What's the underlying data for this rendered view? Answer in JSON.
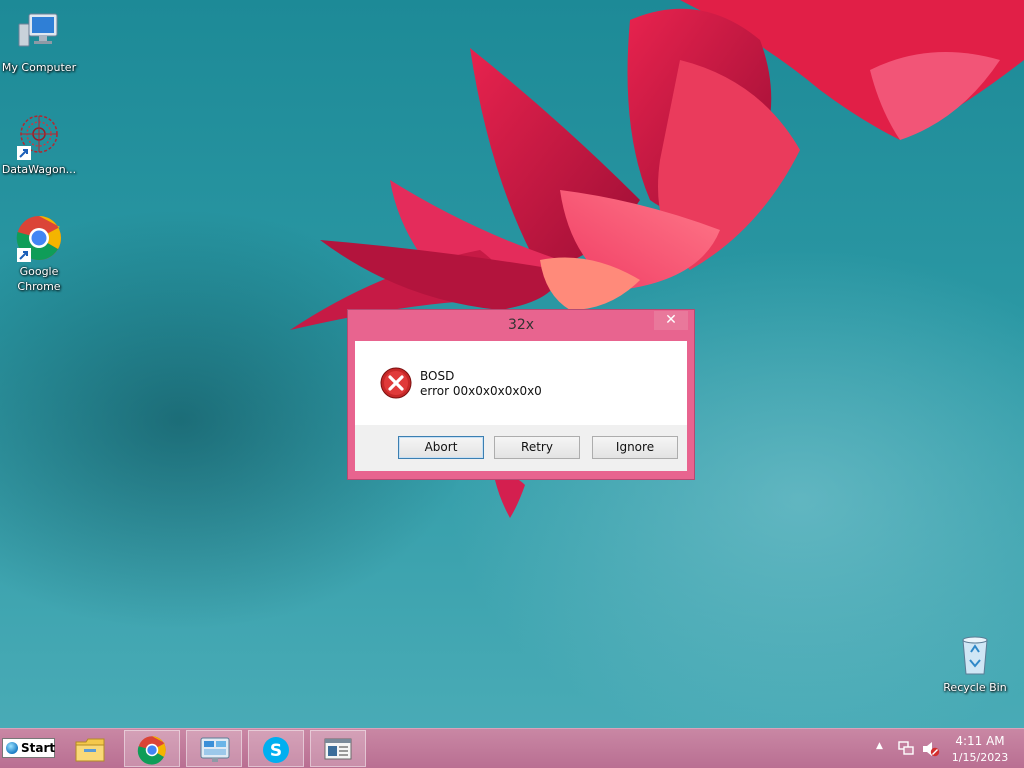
{
  "desktop": {
    "icons": [
      {
        "label": "My Computer",
        "icon": "computer-icon"
      },
      {
        "label": "DataWagon...",
        "icon": "datawagon-icon"
      },
      {
        "label": "Google Chrome",
        "icon": "chrome-icon"
      },
      {
        "label": "Recycle Bin",
        "icon": "recycle-bin-icon"
      }
    ]
  },
  "dialog": {
    "title": "32x",
    "close_glyph": "✕",
    "message_line1": "BOSD",
    "message_line2": "error 00x0x0x0x0x0",
    "icon": "error-icon",
    "buttons": {
      "abort": "Abort",
      "retry": "Retry",
      "ignore": "Ignore"
    }
  },
  "taskbar": {
    "start_label": "Start",
    "items": [
      "file-explorer-icon",
      "chrome-icon",
      "control-panel-icon",
      "skype-icon",
      "window-app-icon"
    ],
    "active_item": "window-app-icon",
    "tray": {
      "arrow": "▲",
      "network_icon": "network-icon",
      "volume_icon": "volume-muted-icon",
      "time": "4:11 AM",
      "date": "1/15/2023"
    }
  },
  "colors": {
    "dialog_frame": "#e8648f",
    "taskbar": "#c987a4",
    "desktop": "#2b98a4"
  }
}
